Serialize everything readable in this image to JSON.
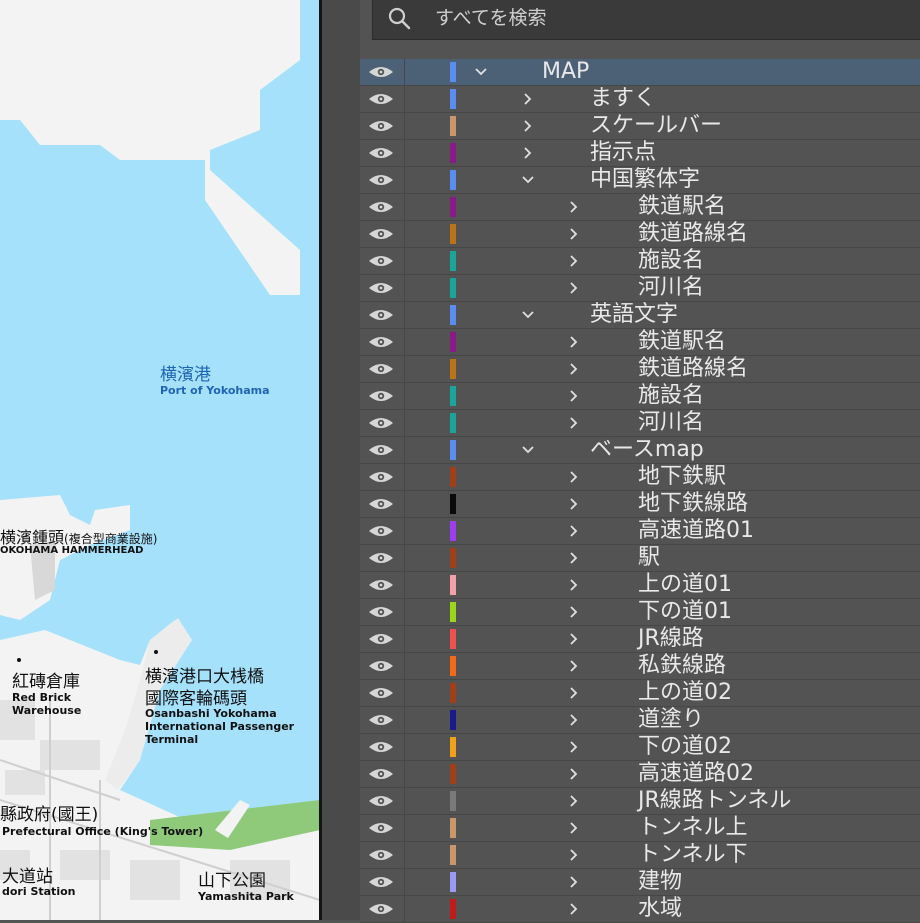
{
  "search": {
    "placeholder": "すべてを検索"
  },
  "map": {
    "port_jp": "横濱港",
    "port_en": "Port of Yokohama",
    "hammerhead_jp": "横濱鍾頭",
    "hammerhead_note": "(複合型商業設施)",
    "hammerhead_en": "OKOHAMA HAMMERHEAD",
    "brick_jp": "紅磚倉庫",
    "brick_en1": "Red Brick",
    "brick_en2": "Warehouse",
    "osanbashi_jp1": "横濱港口大桟橋",
    "osanbashi_jp2": "國際客輪碼頭",
    "osanbashi_en1": "Osanbashi Yokohama",
    "osanbashi_en2": "International Passenger",
    "osanbashi_en3": "Terminal",
    "pref_jp": "縣政府(國王)",
    "pref_en": "Prefectural Office (King's Tower)",
    "station_jp": "大道站",
    "station_en": "dori Station",
    "park_jp": "山下公園",
    "park_en": "Yamashita Park",
    "colors": {
      "water": "#a6e1fb",
      "land": "#f3f3f3",
      "label_blue": "#1e64b4",
      "park": "#8fc97a"
    }
  },
  "layers": [
    {
      "name": "MAP",
      "color": "#5b8cf0",
      "level": 0,
      "expanded": true,
      "selected": true
    },
    {
      "name": "ますく",
      "color": "#5b8cf0",
      "level": 1,
      "expanded": false
    },
    {
      "name": "スケールバー",
      "color": "#c8966a",
      "level": 1,
      "expanded": false
    },
    {
      "name": "指示点",
      "color": "#8a1a8a",
      "level": 1,
      "expanded": false
    },
    {
      "name": "中国繁体字",
      "color": "#5b8cf0",
      "level": 1,
      "expanded": true
    },
    {
      "name": "鉄道駅名",
      "color": "#8a1a8a",
      "level": 2,
      "expanded": false
    },
    {
      "name": "鉄道路線名",
      "color": "#b87416",
      "level": 2,
      "expanded": false
    },
    {
      "name": "施設名",
      "color": "#1aa49a",
      "level": 2,
      "expanded": false
    },
    {
      "name": "河川名",
      "color": "#1aa49a",
      "level": 2,
      "expanded": false
    },
    {
      "name": "英語文字",
      "color": "#5b8cf0",
      "level": 1,
      "expanded": true
    },
    {
      "name": "鉄道駅名",
      "color": "#8a1a8a",
      "level": 2,
      "expanded": false
    },
    {
      "name": "鉄道路線名",
      "color": "#b87416",
      "level": 2,
      "expanded": false
    },
    {
      "name": "施設名",
      "color": "#1aa49a",
      "level": 2,
      "expanded": false
    },
    {
      "name": "河川名",
      "color": "#1aa49a",
      "level": 2,
      "expanded": false
    },
    {
      "name": "ベースmap",
      "color": "#5b8cf0",
      "level": 1,
      "expanded": true
    },
    {
      "name": "地下鉄駅",
      "color": "#a0401a",
      "level": 2,
      "expanded": false
    },
    {
      "name": "地下鉄線路",
      "color": "#0a0a0a",
      "level": 2,
      "expanded": false
    },
    {
      "name": "高速道路01",
      "color": "#9c3ef0",
      "level": 2,
      "expanded": false
    },
    {
      "name": "駅",
      "color": "#a0401a",
      "level": 2,
      "expanded": false
    },
    {
      "name": "上の道01",
      "color": "#f4a0a8",
      "level": 2,
      "expanded": false
    },
    {
      "name": "下の道01",
      "color": "#9ad61a",
      "level": 2,
      "expanded": false
    },
    {
      "name": "JR線路",
      "color": "#f05050",
      "level": 2,
      "expanded": false
    },
    {
      "name": "私鉄線路",
      "color": "#f06a1a",
      "level": 2,
      "expanded": false
    },
    {
      "name": "上の道02",
      "color": "#a0401a",
      "level": 2,
      "expanded": false
    },
    {
      "name": "道塗り",
      "color": "#1a1a8a",
      "level": 2,
      "expanded": false
    },
    {
      "name": "下の道02",
      "color": "#f0a01a",
      "level": 2,
      "expanded": false
    },
    {
      "name": "高速道路02",
      "color": "#a0401a",
      "level": 2,
      "expanded": false
    },
    {
      "name": "JR線路トンネル",
      "color": "#7a7a7a",
      "level": 2,
      "expanded": false
    },
    {
      "name": "トンネル上",
      "color": "#c8966a",
      "level": 2,
      "expanded": false
    },
    {
      "name": "トンネル下",
      "color": "#c8966a",
      "level": 2,
      "expanded": false
    },
    {
      "name": "建物",
      "color": "#9a9af0",
      "level": 2,
      "expanded": false
    },
    {
      "name": "水域",
      "color": "#c01a1a",
      "level": 2,
      "expanded": false
    }
  ]
}
